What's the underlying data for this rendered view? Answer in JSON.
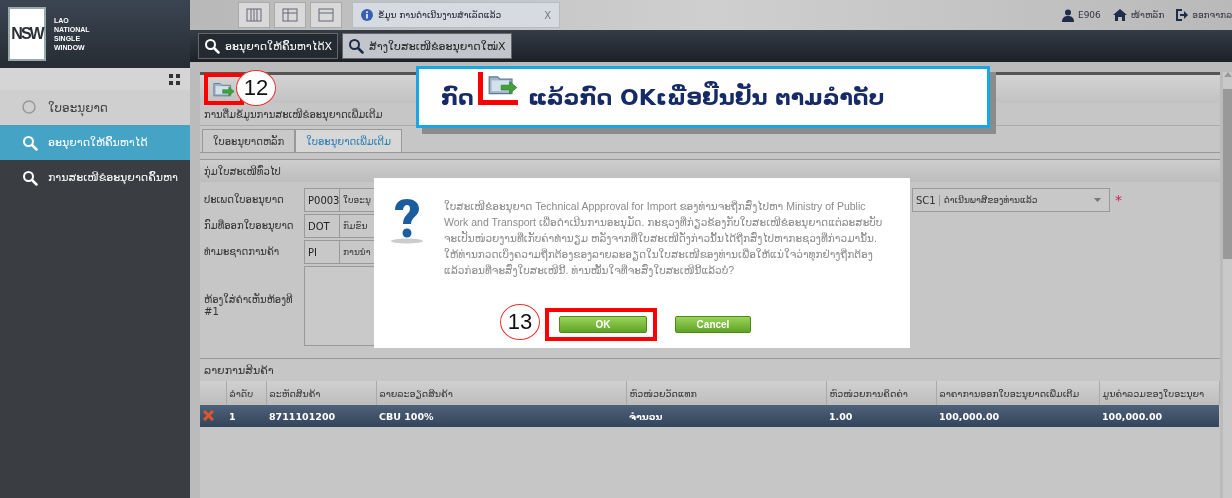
{
  "brand": {
    "logo_text": "NSW",
    "lines": [
      "LAO",
      "NATIONAL",
      "SINGLE",
      "WINDOW"
    ]
  },
  "top_bar": {
    "notice": "ຂໍ້ມູນ ການດຳເນີນງານສຳເລັດແລ້ວ",
    "notice_close": "X",
    "user": "E906",
    "home": "ໜ້າຫລັກ",
    "logout": "ອອກຈາກລ"
  },
  "open_tabs": [
    {
      "label": "ອະນຸຍາດໃຫ້ຄົ້ນຫາໄດ້X",
      "selected": false
    },
    {
      "label": "ສ້າງໃບສະເໜີຂໍອະນຸຍາດໃໝ່X",
      "selected": true
    }
  ],
  "sidebar": {
    "items": [
      {
        "label": "ໃບອະນຸຍາດ",
        "kind": "header",
        "selected": false
      },
      {
        "label": "ອະນຸຍາດໃຫ້ຄົ້ນຫາໄດ້",
        "kind": "link",
        "selected": true
      },
      {
        "label": "ການສະເໜີຂໍອະນຸຍາດຄົ້ນຫາ",
        "kind": "link",
        "selected": false
      }
    ]
  },
  "panel": {
    "toolbar_callout": "12",
    "title": "ການຕື່ມຂໍ້ມູນການສະເໜີຂໍອະນຸຍາດເພີ່ມເຕີມ",
    "tabs": [
      {
        "label": "ໃບອະນຸຍາດຫລັກ",
        "selected": false
      },
      {
        "label": "ໃບອະນຸຍາດເພີ່ມເຕີມ",
        "selected": true
      }
    ],
    "section": "ກຸ່ມໃບສະເໜີທົ່ວໄປ",
    "fields": [
      {
        "label": "ປະເພດໃບອະນຸຍາດ",
        "code": "P0003",
        "value": "ໃບອະນຸ"
      },
      {
        "label": "ກົມທີ່ອອກໃບອະນຸຍາດ",
        "code": "DOT",
        "value": "ກົມຂົນ"
      },
      {
        "label": "ທຳມະຊາດການຄ້າ",
        "code": "PI",
        "value": "ການນຳ"
      }
    ],
    "comment_label": "ຫ້ອງໃສ່ຄຳເຫັນຫ້ອງທີ #1",
    "status_select": {
      "code": "SC1",
      "value": "ດຳເນີນພາສີຂອງທ່ານແລ້ວ",
      "required_mark": "*"
    }
  },
  "goods": {
    "title": "ລາຍການສິນຄ້າ",
    "columns": [
      "ລຳດັບ",
      "ລະຫັດສິນຄ້າ",
      "ລາຍລະອຽດສິນຄ້າ",
      "ຫົວໜ່ວຍວັດແທກ",
      "ຫົວໜ່ວຍການຄິດຄ່າ",
      "ລາຄາການອອກໃບອະນຸຍາດເພີ່ມເຕີມ",
      "ມູນຄ່າລວມຂອງໃບອະນຸຍາ"
    ],
    "rows": [
      {
        "selected": true,
        "cells": [
          "1",
          "8711101200",
          "CBU 100%",
          "ຈຳນວນ",
          "1.00",
          "100,000.00",
          "100,000.00"
        ]
      }
    ]
  },
  "dialog": {
    "message": "ໃບສະເໜີຂໍອະນຸຍາດ Technical Appproval for Import ຂອງທ່ານຈະຖືກສົ່ງໄປຫາ Ministry of Public Work and Transport ເພື່ອດຳເນີນການອະນຸມັດ. ກະຊວງທີ່ກ່ຽວຂ້ອງກັບໃບສະເໜີຂໍອະນຸຍາດແຕ່ລະສະບັບຈະເປັນໜ່ວຍງານທີ່ເກັບຄ່າທຳນຽມ ຫລັງຈາກທີ່ໃບສະເໜີດັ່ງກ່າວນັ້ນໄດ້ຖືກສົ່ງໄປຫາກະຊວງທີ່ກ່າວມານັ້ນ. ໃຫ້ທ່ານກວດເບິ່ງຄວາມຖືກຕ້ອງຂອງລາຍລະອຽດໃນໃບສະເໜີຂອງທ່ານເພື່ອໃຫ້ແນ່ໃຈວ່າທຸກຢ່າງຖືກຕ້ອງແລ້ວກ່ອນທີ່ຈະສົ່ງໃບສະເໜີນີ້. ທ່ານໝັ້ນໃຈທີ່ຈະສົ່ງໃບສະເໜີນີ້ແລ້ວບໍ່?",
    "ok_callout": "13",
    "buttons": [
      {
        "label": "OK",
        "highlighted": true
      },
      {
        "label": "Cancel",
        "highlighted": false
      }
    ]
  },
  "instruction": {
    "before": "ກົດ",
    "after": "ແລ້ວກົດ OKເພື່ອຢືນຢັນ ຕາມລຳດັບ"
  }
}
